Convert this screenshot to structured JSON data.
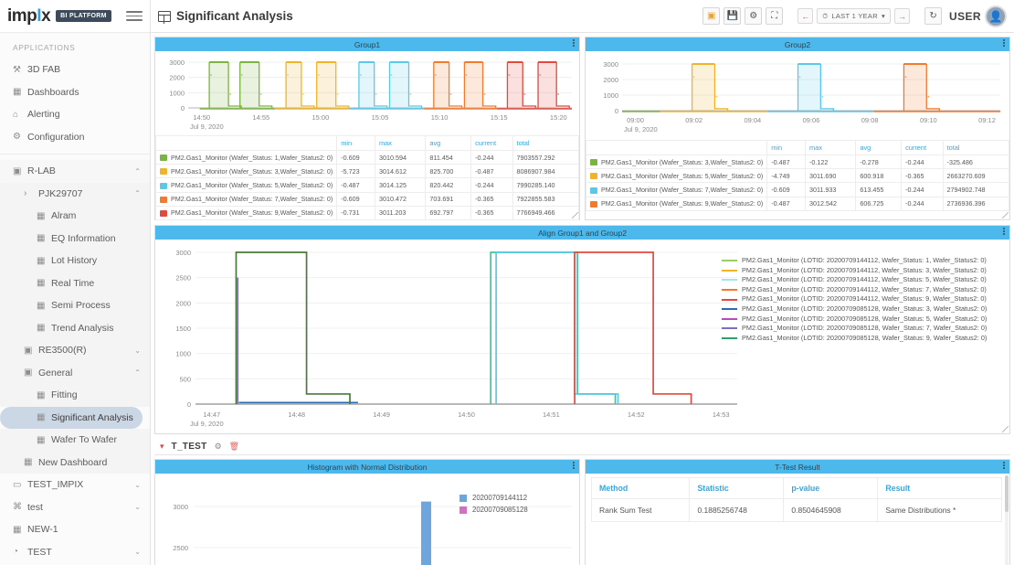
{
  "brand": {
    "logo_text_1": "imp",
    "logo_dot": "I",
    "logo_text_2": "x",
    "badge": "BI PLATFORM",
    "menu_icon": "hamburger-icon"
  },
  "header": {
    "title": "Significant Analysis",
    "user_label": "USER",
    "time_range": "LAST 1 YEAR"
  },
  "sidebar": {
    "section_label": "APPLICATIONS",
    "items": [
      {
        "label": "3D FAB",
        "icon": "wrench-icon",
        "level": 1,
        "caret": ""
      },
      {
        "label": "Dashboards",
        "icon": "grid-icon",
        "level": 1,
        "caret": ""
      },
      {
        "label": "Alerting",
        "icon": "bell-icon",
        "level": 1,
        "caret": ""
      },
      {
        "label": "Configuration",
        "icon": "gear-icon",
        "level": 1,
        "caret": ""
      }
    ],
    "tree": [
      {
        "label": "R-LAB",
        "icon": "folder-icon",
        "level": 1,
        "caret": "⌃",
        "group": true,
        "active": false
      },
      {
        "label": "PJK29707",
        "icon": "›",
        "level": 2,
        "caret": "⌃",
        "group": false,
        "active": false,
        "chevron": true
      },
      {
        "label": "Alram",
        "icon": "dashboard-icon",
        "level": 3,
        "caret": "",
        "group": false,
        "active": false
      },
      {
        "label": "EQ Information",
        "icon": "dashboard-icon",
        "level": 3,
        "caret": "",
        "group": false,
        "active": false
      },
      {
        "label": "Lot History",
        "icon": "dashboard-icon",
        "level": 3,
        "caret": "",
        "group": false,
        "active": false
      },
      {
        "label": "Real Time",
        "icon": "dashboard-icon",
        "level": 3,
        "caret": "",
        "group": false,
        "active": false
      },
      {
        "label": "Semi Process",
        "icon": "dashboard-icon",
        "level": 3,
        "caret": "",
        "group": false,
        "active": false
      },
      {
        "label": "Trend Analysis",
        "icon": "dashboard-icon",
        "level": 3,
        "caret": "",
        "group": false,
        "active": false
      },
      {
        "label": "RE3500(R)",
        "icon": "folder-icon",
        "level": 2,
        "caret": "⌄",
        "group": false,
        "active": false
      },
      {
        "label": "General",
        "icon": "folder-icon",
        "level": 2,
        "caret": "⌃",
        "group": false,
        "active": false
      },
      {
        "label": "Fitting",
        "icon": "dashboard-icon",
        "level": 3,
        "caret": "",
        "group": false,
        "active": false
      },
      {
        "label": "Significant Analysis",
        "icon": "dashboard-icon",
        "level": 3,
        "caret": "",
        "group": false,
        "active": true
      },
      {
        "label": "Wafer To Wafer",
        "icon": "dashboard-icon",
        "level": 3,
        "caret": "",
        "group": false,
        "active": false
      },
      {
        "label": "New Dashboard",
        "icon": "dashboard-icon",
        "level": 2,
        "caret": "",
        "group": false,
        "active": false
      },
      {
        "label": "TEST_IMPIX",
        "icon": "monitor-icon",
        "level": 1,
        "caret": "⌄",
        "group": false,
        "active": false
      },
      {
        "label": "test",
        "icon": "plug-icon",
        "level": 1,
        "caret": "⌄",
        "group": false,
        "active": false
      },
      {
        "label": "NEW-1",
        "icon": "dashboard-icon",
        "level": 1,
        "caret": "",
        "group": false,
        "active": false
      },
      {
        "label": "TEST",
        "icon": "clock-icon",
        "level": 1,
        "caret": "⌄",
        "group": false,
        "active": false
      }
    ]
  },
  "colors": {
    "panel_header": "#4db8ec",
    "accent": "#3aa6e0",
    "s1_green": "#7cb342",
    "s2_yellow": "#f0b429",
    "s3_cyan": "#5bc8e8",
    "s4_orange": "#f07a2e",
    "s5_red": "#e04a3f",
    "s6_blue": "#2b6cb0",
    "s7_magenta": "#b84bb8",
    "s8_purple": "#7a6fc4",
    "s9_green2": "#2f9e6e",
    "hist_blue": "#6ca6dc",
    "hist_pink": "#d46fc8"
  },
  "panels": {
    "group1": {
      "title": "Group1"
    },
    "group2": {
      "title": "Group2"
    },
    "align": {
      "title": "Align Group1 and Group2"
    },
    "histogram": {
      "title": "Histogram with Normal Distribution"
    },
    "ttest": {
      "title": "T-Test Result"
    }
  },
  "ttest_section": {
    "label": "T_TEST",
    "gear_icon": "gear-icon",
    "delete_icon": "trash-icon",
    "caret_icon": "chevron-down-icon"
  },
  "table_headers": [
    "",
    "min",
    "max",
    "avg",
    "current",
    "total"
  ],
  "group1_rows": [
    {
      "color": "#7cb342",
      "name": "PM2.Gas1_Monitor (Wafer_Status: 1,Wafer_Status2: 0)",
      "min": "-0.609",
      "max": "3010.594",
      "avg": "811.454",
      "current": "-0.244",
      "total": "7903557.292"
    },
    {
      "color": "#f0b429",
      "name": "PM2.Gas1_Monitor (Wafer_Status: 3,Wafer_Status2: 0)",
      "min": "-5.723",
      "max": "3014.612",
      "avg": "825.700",
      "current": "-0.487",
      "total": "8086907.984"
    },
    {
      "color": "#5bc8e8",
      "name": "PM2.Gas1_Monitor (Wafer_Status: 5,Wafer_Status2: 0)",
      "min": "-0.487",
      "max": "3014.125",
      "avg": "820.442",
      "current": "-0.244",
      "total": "7990285.140"
    },
    {
      "color": "#f07a2e",
      "name": "PM2.Gas1_Monitor (Wafer_Status: 7,Wafer_Status2: 0)",
      "min": "-0.609",
      "max": "3010.472",
      "avg": "703.691",
      "current": "-0.365",
      "total": "7922855.583"
    },
    {
      "color": "#e04a3f",
      "name": "PM2.Gas1_Monitor (Wafer_Status: 9,Wafer_Status2: 0)",
      "min": "-0.731",
      "max": "3011.203",
      "avg": "692.797",
      "current": "-0.365",
      "total": "7766949.466"
    }
  ],
  "group2_rows": [
    {
      "color": "#7cb342",
      "name": "PM2.Gas1_Monitor (Wafer_Status: 3,Wafer_Status2: 0)",
      "min": "-0.487",
      "max": "-0.122",
      "avg": "-0.278",
      "current": "-0.244",
      "total": "-325.486"
    },
    {
      "color": "#f0b429",
      "name": "PM2.Gas1_Monitor (Wafer_Status: 5,Wafer_Status2: 0)",
      "min": "-4.749",
      "max": "3011.690",
      "avg": "600.918",
      "current": "-0.365",
      "total": "2663270.609"
    },
    {
      "color": "#5bc8e8",
      "name": "PM2.Gas1_Monitor (Wafer_Status: 7,Wafer_Status2: 0)",
      "min": "-0.609",
      "max": "3011.933",
      "avg": "613.455",
      "current": "-0.244",
      "total": "2794902.748"
    },
    {
      "color": "#f07a2e",
      "name": "PM2.Gas1_Monitor (Wafer_Status: 9,Wafer_Status2: 0)",
      "min": "-0.487",
      "max": "3012.542",
      "avg": "606.725",
      "current": "-0.244",
      "total": "2736936.396"
    }
  ],
  "align_legend": [
    {
      "color": "#9ccc65",
      "label": "PM2.Gas1_Monitor (LOTID: 20200709144112, Wafer_Status: 1, Wafer_Status2: 0)"
    },
    {
      "color": "#f0b429",
      "label": "PM2.Gas1_Monitor (LOTID: 20200709144112, Wafer_Status: 3, Wafer_Status2: 0)"
    },
    {
      "color": "#a5e3ef",
      "label": "PM2.Gas1_Monitor (LOTID: 20200709144112, Wafer_Status: 5, Wafer_Status2: 0)"
    },
    {
      "color": "#f07a2e",
      "label": "PM2.Gas1_Monitor (LOTID: 20200709144112, Wafer_Status: 7, Wafer_Status2: 0)"
    },
    {
      "color": "#e04a3f",
      "label": "PM2.Gas1_Monitor (LOTID: 20200709144112, Wafer_Status: 9, Wafer_Status2: 0)"
    },
    {
      "color": "#2b6cb0",
      "label": "PM2.Gas1_Monitor (LOTID: 20200709085128, Wafer_Status: 3, Wafer_Status2: 0)"
    },
    {
      "color": "#b84bb8",
      "label": "PM2.Gas1_Monitor (LOTID: 20200709085128, Wafer_Status: 5, Wafer_Status2: 0)"
    },
    {
      "color": "#7a6fc4",
      "label": "PM2.Gas1_Monitor (LOTID: 20200709085128, Wafer_Status: 7, Wafer_Status2: 0)"
    },
    {
      "color": "#2f9e6e",
      "label": "PM2.Gas1_Monitor (LOTID: 20200709085128, Wafer_Status: 9, Wafer_Status2: 0)"
    }
  ],
  "histogram_legend": [
    {
      "color": "#6ca6dc",
      "label": "20200709144112"
    },
    {
      "color": "#d46fc8",
      "label": "20200709085128"
    }
  ],
  "ttest_table": {
    "headers": [
      "Method",
      "Statistic",
      "p-value",
      "Result"
    ],
    "rows": [
      {
        "method": "Rank Sum Test",
        "statistic": "0.1885256748",
        "pvalue": "0.8504645908",
        "result": "Same Distributions *"
      }
    ]
  },
  "chart_data": [
    {
      "id": "group1",
      "type": "line",
      "title": "Group1",
      "xlabel": "Jul 9, 2020",
      "ylabel": "",
      "ylim": [
        0,
        3000
      ],
      "yticks": [
        0,
        1000,
        2000,
        3000
      ],
      "xticks": [
        "14:50",
        "14:55",
        "15:00",
        "15:05",
        "15:10",
        "15:15",
        "15:20"
      ],
      "date_label": "Jul 9, 2020",
      "series": [
        {
          "name": "PM2.Gas1_Monitor (Wafer_Status: 1,Wafer_Status2: 0)",
          "color": "#7cb342",
          "pulses": [
            [
              0.055,
              0.105
            ],
            [
              0.135,
              0.185
            ]
          ],
          "baseline": 0,
          "peak": 3000,
          "span": [
            0.03,
            0.225
          ]
        },
        {
          "name": "PM2.Gas1_Monitor (Wafer_Status: 3,Wafer_Status2: 0)",
          "color": "#f0b429",
          "pulses": [
            [
              0.255,
              0.295
            ],
            [
              0.335,
              0.385
            ]
          ],
          "baseline": 0,
          "peak": 3000,
          "span": [
            0.225,
            0.42
          ]
        },
        {
          "name": "PM2.Gas1_Monitor (Wafer_Status: 5,Wafer_Status2: 0)",
          "color": "#5bc8e8",
          "pulses": [
            [
              0.445,
              0.485
            ],
            [
              0.525,
              0.575
            ]
          ],
          "baseline": 0,
          "peak": 3000,
          "span": [
            0.42,
            0.615
          ]
        },
        {
          "name": "PM2.Gas1_Monitor (Wafer_Status: 7,Wafer_Status2: 0)",
          "color": "#f07a2e",
          "pulses": [
            [
              0.64,
              0.68
            ],
            [
              0.72,
              0.768
            ]
          ],
          "baseline": 0,
          "peak": 3000,
          "span": [
            0.615,
            0.805
          ]
        },
        {
          "name": "PM2.Gas1_Monitor (Wafer_Status: 9,Wafer_Status2: 0)",
          "color": "#e04a3f",
          "pulses": [
            [
              0.832,
              0.872
            ],
            [
              0.912,
              0.96
            ]
          ],
          "baseline": 0,
          "peak": 3000,
          "span": [
            0.805,
            1.0
          ]
        }
      ]
    },
    {
      "id": "group2",
      "type": "line",
      "title": "Group2",
      "xlabel": "Jul 9, 2020",
      "ylim": [
        0,
        3000
      ],
      "yticks": [
        0,
        1000,
        2000,
        3000
      ],
      "xticks": [
        "09:00",
        "09:02",
        "09:04",
        "09:06",
        "09:08",
        "09:10",
        "09:12"
      ],
      "date_label": "Jul 9, 2020",
      "series": [
        {
          "name": "PM2.Gas1_Monitor (Wafer_Status: 3,Wafer_Status2: 0)",
          "color": "#7cb342",
          "pulses": [],
          "baseline": 0,
          "peak": 0,
          "span": [
            0.0,
            0.1
          ]
        },
        {
          "name": "PM2.Gas1_Monitor (Wafer_Status: 5,Wafer_Status2: 0)",
          "color": "#f0b429",
          "pulses": [
            [
              0.185,
              0.245
            ]
          ],
          "baseline": 0,
          "peak": 3000,
          "span": [
            0.1,
            0.385
          ]
        },
        {
          "name": "PM2.Gas1_Monitor (Wafer_Status: 7,Wafer_Status2: 0)",
          "color": "#5bc8e8",
          "pulses": [
            [
              0.465,
              0.525
            ]
          ],
          "baseline": 0,
          "peak": 3000,
          "span": [
            0.385,
            0.665
          ]
        },
        {
          "name": "PM2.Gas1_Monitor (Wafer_Status: 9,Wafer_Status2: 0)",
          "color": "#f07a2e",
          "pulses": [
            [
              0.745,
              0.805
            ]
          ],
          "baseline": 0,
          "peak": 3000,
          "span": [
            0.665,
            1.0
          ]
        }
      ]
    },
    {
      "id": "align",
      "type": "line",
      "title": "Align Group1 and Group2",
      "ylim": [
        0,
        3000
      ],
      "yticks": [
        0,
        500,
        1000,
        1500,
        2000,
        2500,
        3000
      ],
      "xticks": [
        "14:47",
        "14:48",
        "14:49",
        "14:50",
        "14:51",
        "14:52",
        "14:53"
      ],
      "date_label": "Jul 9, 2020",
      "pulses": [
        {
          "color": "#4a7a3a",
          "start": 0.075,
          "end": 0.205,
          "top": 3000,
          "shoulder": 200,
          "shoulder_end": 0.285
        },
        {
          "color": "#3fc49b",
          "start": 0.545,
          "end": 0.705,
          "top": 3000,
          "shoulder": 200,
          "shoulder_end": 0.775
        },
        {
          "color": "#5bc8e8",
          "start": 0.555,
          "end": 0.7,
          "top": 3000,
          "shoulder": 200,
          "shoulder_end": 0.78
        },
        {
          "color": "#e04a3f",
          "start": 0.7,
          "end": 0.845,
          "top": 3000,
          "shoulder": 200,
          "shoulder_end": 0.915
        }
      ]
    },
    {
      "id": "histogram",
      "type": "bar",
      "title": "Histogram with Normal Distribution",
      "yticks": [
        2500,
        3000
      ],
      "ylim": [
        2300,
        3200
      ],
      "series": [
        {
          "name": "20200709144112",
          "color": "#6ca6dc",
          "values": [
            3060
          ]
        },
        {
          "name": "20200709085128",
          "color": "#d46fc8",
          "values": []
        }
      ]
    }
  ]
}
